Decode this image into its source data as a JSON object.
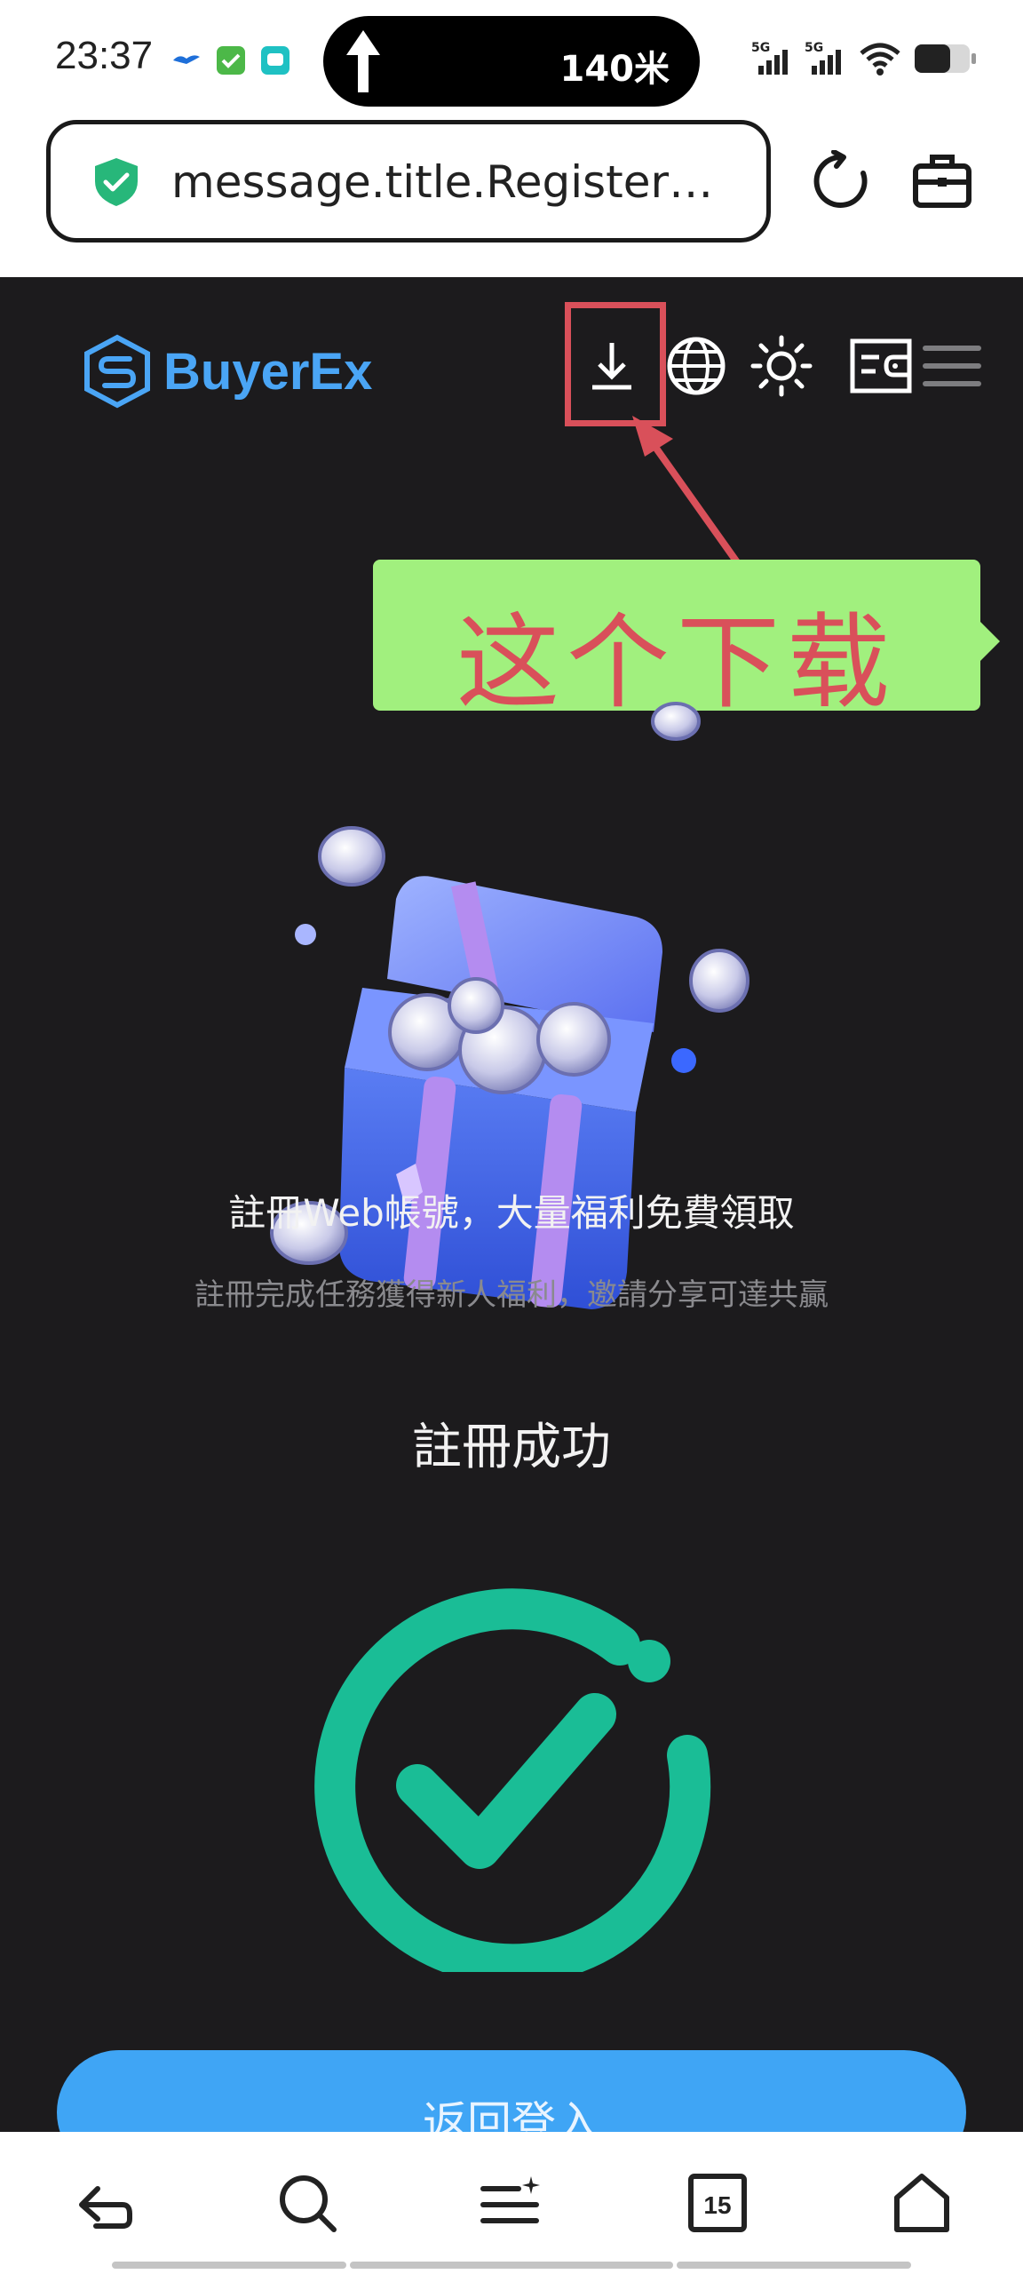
{
  "status_bar": {
    "time": "23:37",
    "navigation_distance": "140米",
    "signal_1_label": "5G",
    "signal_2_label": "5G"
  },
  "browser": {
    "url_text": "message.title.Register…",
    "icons": [
      "shield-check-icon",
      "refresh-icon",
      "toolbox-icon"
    ]
  },
  "header": {
    "brand_name": "BuyerEx",
    "icons": [
      "download-icon",
      "globe-icon",
      "sun-icon",
      "wallet-icon",
      "menu-icon"
    ]
  },
  "annotation": {
    "text": "这个下载",
    "color": "#d9505a",
    "background": "#a1f07e"
  },
  "promo": {
    "headline": "註冊Web帳號，大量福利免費領取",
    "subline": "註冊完成任務獲得新人福利，邀請分享可達共贏"
  },
  "result": {
    "title": "註冊成功",
    "icon": "success-check-icon",
    "accent_color": "#1abd96"
  },
  "actions": {
    "back_to_login": "返回登入"
  },
  "bottom_nav": {
    "tabs_count": "15",
    "icons": [
      "back-icon",
      "search-icon",
      "menu-list-icon",
      "tabs-icon",
      "home-icon"
    ]
  }
}
